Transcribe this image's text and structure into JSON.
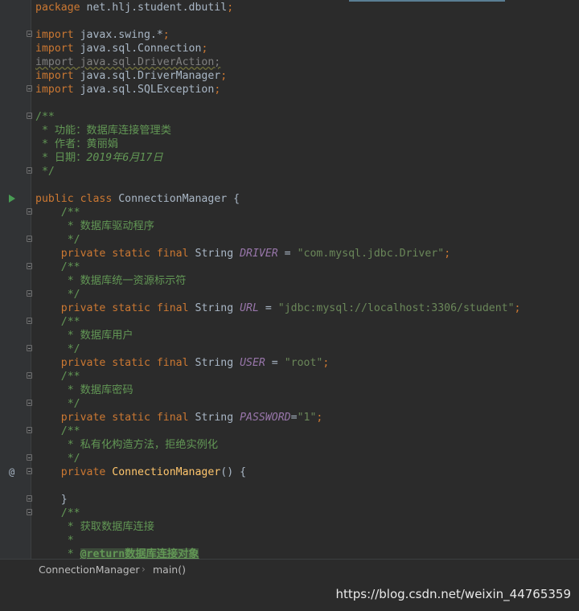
{
  "code": {
    "l_package": [
      "package",
      " net.hlj.student.dbutil",
      ";"
    ],
    "l_imp1": [
      "import",
      " javax.swing.*",
      ";"
    ],
    "l_imp2": [
      "import",
      " java.sql.Connection",
      ";"
    ],
    "l_imp3": "import java.sql.DriverAction;",
    "l_imp4": [
      "import",
      " java.sql.DriverManager",
      ";"
    ],
    "l_imp5": [
      "import",
      " java.sql.SQLException",
      ";"
    ],
    "doc_open": "/**",
    "doc_func": " * 功能：数据库连接管理类",
    "doc_author": " * 作者：黄丽娟",
    "doc_date_label": " * 日期：",
    "doc_date_value": "2019年6月17日",
    "doc_close": " */",
    "class_line": [
      "public class",
      " ConnectionManager {"
    ],
    "c1": "    /**",
    "c1_text": "     * 数据库驱动程序",
    "c1_close": "     */",
    "driver": {
      "mods": "    private static final",
      " type": " String ",
      "name": "DRIVER",
      "eq": " = ",
      "val": "\"com.mysql.jdbc.Driver\"",
      "end": ";"
    },
    "c2": "    /**",
    "c2_text": "     * 数据库统一资源标示符",
    "c2_close": "     */",
    "url": {
      "mods": "    private static final",
      "type": " String ",
      "name": "URL",
      "eq": " = ",
      "val": "\"jdbc:mysql://localhost:3306/student\"",
      "end": ";"
    },
    "c3": "    /**",
    "c3_text": "     * 数据库用户",
    "c3_close": "     */",
    "user": {
      "mods": "    private static final",
      "type": " String ",
      "name": "USER",
      "eq": " = ",
      "val": "\"root\"",
      "end": ";"
    },
    "c4": "    /**",
    "c4_text": "     * 数据库密码",
    "c4_close": "     */",
    "pwd": {
      "mods": "    private static final",
      "type": " String ",
      "name": "PASSWORD",
      "eq": "=",
      "val": "\"1\"",
      "end": ";"
    },
    "c5": "    /**",
    "c5_text": "     * 私有化构造方法，拒绝实例化",
    "c5_close": "     */",
    "ctor": {
      "mods": "    private ",
      "name": "ConnectionManager",
      "rest": "() {"
    },
    "ctor_close": "    }",
    "c6": "    /**",
    "c6_text": "     * 获取数据库连接",
    "c6_star": "     *",
    "c6_ret_prefix": "     * ",
    "c6_ret_tag": "@return",
    "c6_ret_text": "数据库连接对象"
  },
  "gutter": {
    "run_icon": "run-arrow-icon",
    "override_icon": "@"
  },
  "breadcrumb": {
    "item1": "ConnectionManager",
    "sep": "›",
    "item2": "main()"
  },
  "watermark": "https://blog.csdn.net/weixin_44765359",
  "colors": {
    "background": "#2b2b2b",
    "keyword": "#cc7832",
    "string": "#6a8759",
    "comment": "#629755",
    "field": "#9876aa",
    "method": "#ffc66d"
  }
}
